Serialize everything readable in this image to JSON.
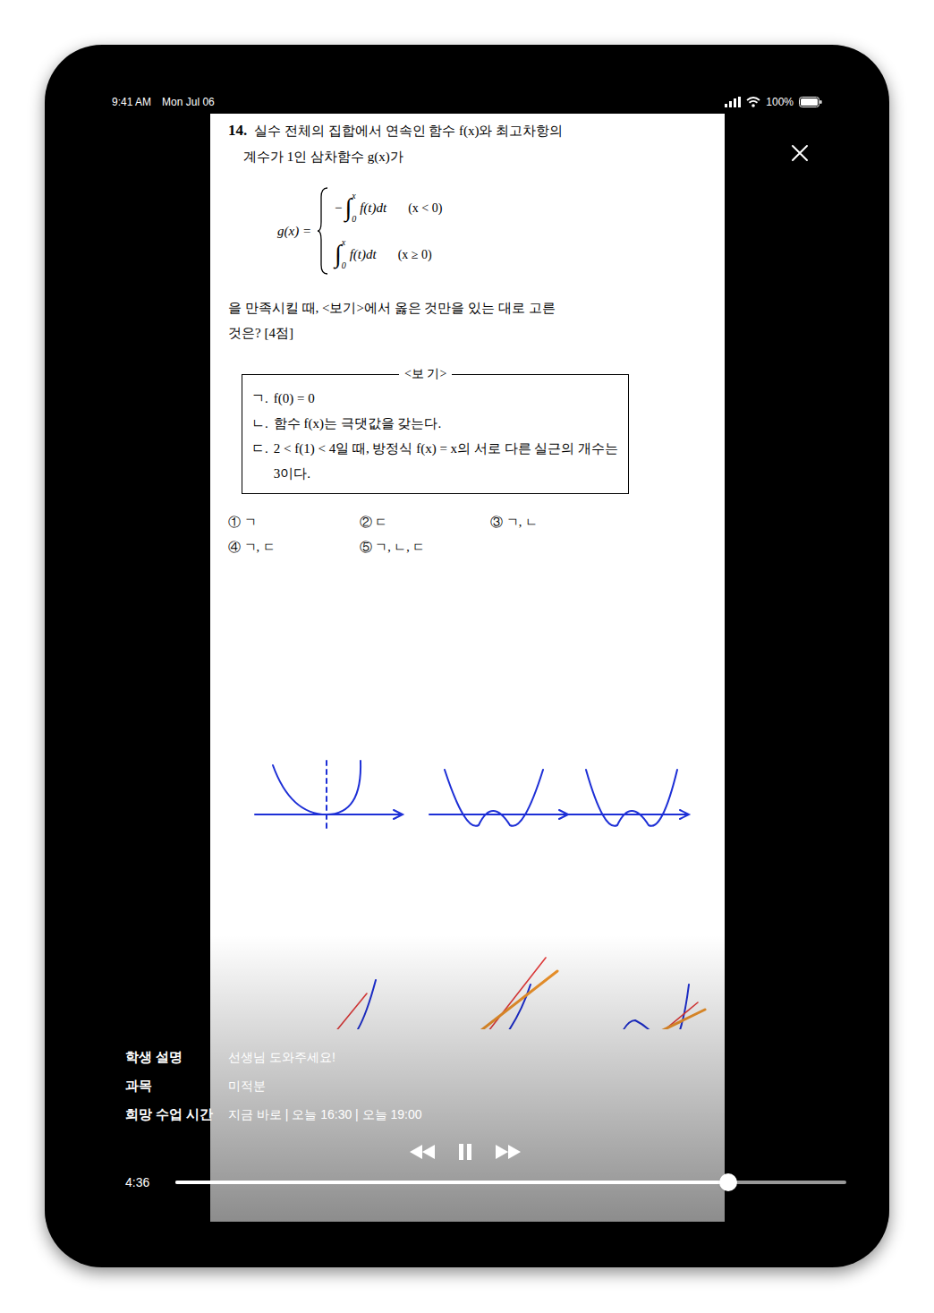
{
  "status_bar": {
    "time": "9:41 AM",
    "date": "Mon Jul 06",
    "battery": "100%"
  },
  "document": {
    "number": "14.",
    "intro_lines": [
      "실수 전체의 집합에서 연속인 함수 f(x)와 최고차항의",
      "계수가 1인 삼차함수 g(x)가"
    ],
    "formula": {
      "lhs": "g(x) =",
      "cases": [
        {
          "sign": "−",
          "integral": "∫",
          "upper": "x",
          "lower": "0",
          "integrand": "f(t)dt",
          "condition": "(x < 0)"
        },
        {
          "integral": "∫",
          "upper": "x",
          "lower": "0",
          "integrand": "f(t)dt",
          "condition": "(x ≥ 0)"
        }
      ]
    },
    "question_lines": [
      "을 만족시킬 때, <보기>에서 옳은 것만을 있는 대로 고른",
      "것은? [4점]"
    ],
    "box_title": "<보 기>",
    "statements": [
      {
        "label": "ㄱ.",
        "text": "f(0) = 0"
      },
      {
        "label": "ㄴ.",
        "text": "함수 f(x)는 극댓값을 갖는다."
      },
      {
        "label": "ㄷ.",
        "text": "2 < f(1) < 4일 때, 방정식 f(x) = x의 서로 다른 실근의 개수는 3이다."
      }
    ],
    "choices": [
      "① ㄱ",
      "② ㄷ",
      "③ ㄱ, ㄴ",
      "④ ㄱ, ㄷ",
      "⑤ ㄱ, ㄴ, ㄷ"
    ]
  },
  "info": [
    {
      "label": "학생 설명",
      "value": "선생님 도와주세요!"
    },
    {
      "label": "과목",
      "value": "미적분"
    },
    {
      "label": "희망 수업 시간",
      "value": "지금 바로 | 오늘 16:30 | 오늘 19:00"
    }
  ],
  "player": {
    "elapsed": "4:36",
    "level": 0.824,
    "playing": true
  }
}
